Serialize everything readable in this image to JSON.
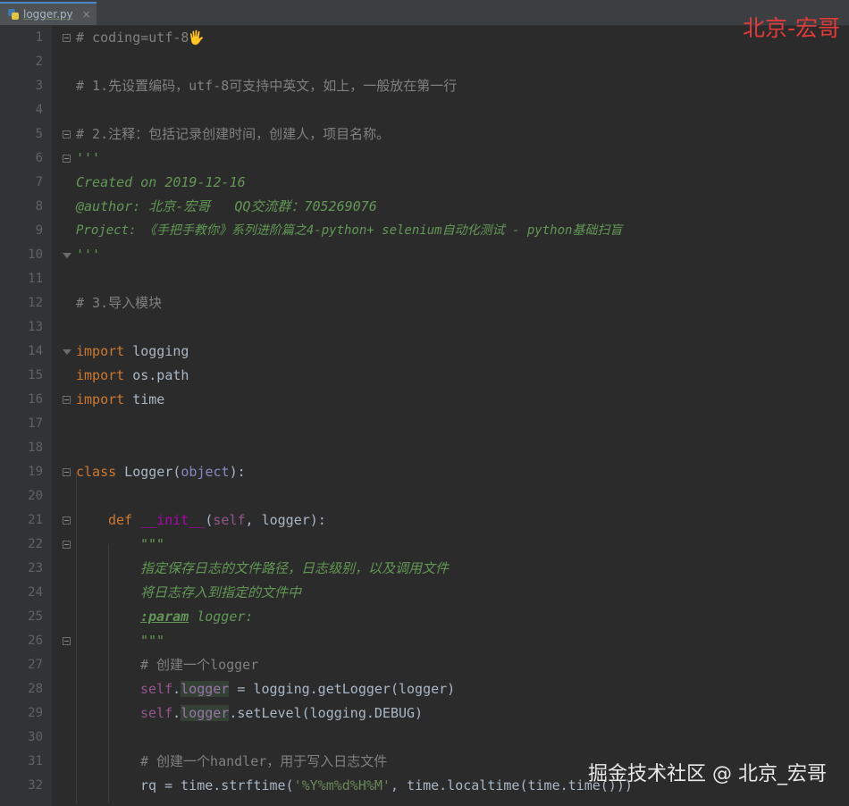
{
  "tab": {
    "file_name": "logger.py",
    "close_glyph": "×",
    "icon": "python-file-icon"
  },
  "watermark_top": "北京-宏哥",
  "watermark_bottom": "掘金技术社区 @ 北京_宏哥",
  "lines": [
    {
      "n": "1",
      "t": "# coding=utf-8"
    },
    {
      "n": "2",
      "t": ""
    },
    {
      "n": "3",
      "t": "# 1.先设置编码，utf-8可支持中英文，如上，一般放在第一行"
    },
    {
      "n": "4",
      "t": ""
    },
    {
      "n": "5",
      "t": "# 2.注释：包括记录创建时间，创建人，项目名称。"
    },
    {
      "n": "6",
      "t": "'''"
    },
    {
      "n": "7",
      "t": "Created on 2019-12-16"
    },
    {
      "n": "8",
      "t": "@author: 北京-宏哥   QQ交流群：705269076"
    },
    {
      "n": "9",
      "t": "Project: 《手把手教你》系列进阶篇之4-python+ selenium自动化测试 - python基础扫盲"
    },
    {
      "n": "10",
      "t": "'''"
    },
    {
      "n": "11",
      "t": ""
    },
    {
      "n": "12",
      "t": "# 3.导入模块"
    },
    {
      "n": "13",
      "t": ""
    },
    {
      "n": "14",
      "kw": "import",
      "rest": " logging"
    },
    {
      "n": "15",
      "kw": "import",
      "rest": " os.path"
    },
    {
      "n": "16",
      "kw": "import",
      "rest": " time"
    },
    {
      "n": "17",
      "t": ""
    },
    {
      "n": "18",
      "t": ""
    },
    {
      "n": "19",
      "kw": "class",
      "rest": " Logger(",
      "self": "object",
      "rest2": "):"
    },
    {
      "n": "20",
      "t": ""
    },
    {
      "n": "21",
      "kw": "def",
      "fn": "__init__",
      "p1": "(",
      "self": "self",
      "rest": ", logger):"
    },
    {
      "n": "22",
      "t": "\"\"\""
    },
    {
      "n": "23",
      "t": "指定保存日志的文件路径，日志级别，以及调用文件"
    },
    {
      "n": "24",
      "t": "将日志存入到指定的文件中"
    },
    {
      "n": "25",
      "tag": ":param",
      "t": " logger:"
    },
    {
      "n": "26",
      "t": "\"\"\""
    },
    {
      "n": "27",
      "t": "# 创建一个logger"
    },
    {
      "n": "28",
      "self": "self",
      "attr": "logger",
      "rest": " = logging.getLogger(logger)"
    },
    {
      "n": "29",
      "self": "self",
      "attr": "logger",
      "rest": ".setLevel(logging.DEBUG)"
    },
    {
      "n": "30",
      "t": ""
    },
    {
      "n": "31",
      "t": "# 创建一个handler，用于写入日志文件"
    },
    {
      "n": "32",
      "pre": "rq = time.strftime(",
      "str": "'%Y%m%d%H%M'",
      "rest": ", time.localtime(time.time()))"
    }
  ],
  "colors": {
    "background": "#2b2b2b",
    "gutter": "#313335",
    "keyword": "#cc7832",
    "comment": "#808080",
    "docstring": "#629755",
    "self": "#94558d",
    "string": "#6a8759",
    "magic": "#b200b2",
    "watermark_red": "#e03a3a"
  }
}
